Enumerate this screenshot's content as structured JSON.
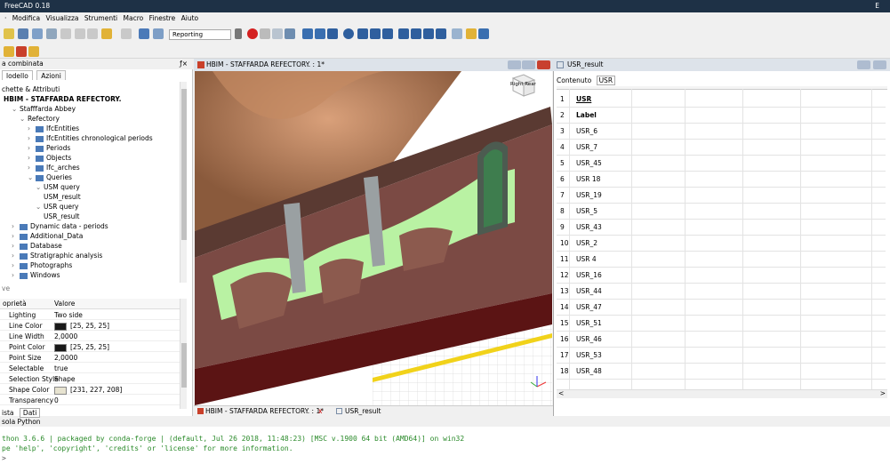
{
  "window": {
    "title": "FreeCAD 0.18",
    "control": "E"
  },
  "menu": [
    "Modifica",
    "Visualizza",
    "Strumenti",
    "Macro",
    "Finestre",
    "Aiuto"
  ],
  "toolbar": {
    "workbench": "Reporting"
  },
  "left_panel": {
    "title": "a combinata",
    "tabs": [
      "lodello",
      "Azioni"
    ],
    "section": "chette & Attributi",
    "tree": [
      {
        "indent": 0,
        "label": "HBIM - STAFFARDA REFECTORY.",
        "bold": true,
        "icon": "document-icon"
      },
      {
        "indent": 1,
        "label": "Stafffarda Abbey",
        "caret": "v"
      },
      {
        "indent": 2,
        "label": "Refectory",
        "caret": "v"
      },
      {
        "indent": 3,
        "label": "IfcEntities",
        "caret": ">",
        "icon": "folder"
      },
      {
        "indent": 3,
        "label": "IfcEntities chronological periods",
        "caret": ">",
        "icon": "folder"
      },
      {
        "indent": 3,
        "label": "Periods",
        "caret": ">",
        "icon": "folder"
      },
      {
        "indent": 3,
        "label": "Objects",
        "caret": ">",
        "icon": "folder"
      },
      {
        "indent": 3,
        "label": "Ifc_arches",
        "caret": ">",
        "icon": "folder"
      },
      {
        "indent": 3,
        "label": "Queries",
        "caret": "v",
        "icon": "folder"
      },
      {
        "indent": 4,
        "label": "USM query",
        "caret": "v"
      },
      {
        "indent": 5,
        "label": "USM_result"
      },
      {
        "indent": 4,
        "label": "USR query",
        "caret": "v"
      },
      {
        "indent": 5,
        "label": "USR_result"
      },
      {
        "indent": 1,
        "label": "Dynamic data - periods",
        "caret": ">",
        "icon": "folder"
      },
      {
        "indent": 1,
        "label": "Additional_Data",
        "caret": ">",
        "icon": "folder"
      },
      {
        "indent": 1,
        "label": "Database",
        "caret": ">",
        "icon": "folder"
      },
      {
        "indent": 1,
        "label": "Stratigraphic analysis",
        "caret": ">",
        "icon": "folder"
      },
      {
        "indent": 1,
        "label": "Photographs",
        "caret": ">",
        "icon": "folder"
      },
      {
        "indent": 1,
        "label": "Windows",
        "caret": ">",
        "icon": "folder"
      }
    ],
    "sub_label": "ve",
    "props_header": {
      "prop": "oprietà",
      "value": "Valore"
    },
    "props": [
      {
        "k": "Lighting",
        "v": "Two side"
      },
      {
        "k": "Line Color",
        "v": "[25, 25, 25]",
        "swatch": "#191919"
      },
      {
        "k": "Line Width",
        "v": "2,0000"
      },
      {
        "k": "Point Color",
        "v": "[25, 25, 25]",
        "swatch": "#191919"
      },
      {
        "k": "Point Size",
        "v": "2,0000"
      },
      {
        "k": "Selectable",
        "v": "true"
      },
      {
        "k": "Selection Style",
        "v": "Shape"
      },
      {
        "k": "Shape Color",
        "v": "[231, 227, 208]",
        "swatch": "#e7e3d0"
      },
      {
        "k": "Transparency",
        "v": "0"
      }
    ],
    "bottom_tabs": [
      "ista",
      "Dati"
    ]
  },
  "view3d": {
    "title": "HBIM - STAFFARDA REFECTORY. : 1*",
    "cube_label": "Right Rear"
  },
  "doc_tabs": [
    "HBIM - STAFFARDA REFECTORY. : 1*",
    "USR_result"
  ],
  "sheet": {
    "title": "USR_result",
    "content_label": "Contenuto",
    "content_value": "USR",
    "rows": [
      {
        "n": "1",
        "v": "USR",
        "bold": true
      },
      {
        "n": "2",
        "v": "Label",
        "bold": true
      },
      {
        "n": "3",
        "v": "USR_6"
      },
      {
        "n": "4",
        "v": "USR_7"
      },
      {
        "n": "5",
        "v": "USR_45"
      },
      {
        "n": "6",
        "v": "USR 18"
      },
      {
        "n": "7",
        "v": "USR_19"
      },
      {
        "n": "8",
        "v": "USR_5"
      },
      {
        "n": "9",
        "v": "USR_43"
      },
      {
        "n": "10",
        "v": "USR_2"
      },
      {
        "n": "11",
        "v": "USR 4"
      },
      {
        "n": "12",
        "v": "USR_16"
      },
      {
        "n": "13",
        "v": "USR_44"
      },
      {
        "n": "14",
        "v": "USR_47"
      },
      {
        "n": "15",
        "v": "USR_51"
      },
      {
        "n": "16",
        "v": "USR_46"
      },
      {
        "n": "17",
        "v": "USR_53"
      },
      {
        "n": "18",
        "v": "USR_48"
      }
    ]
  },
  "console": {
    "title": "sola Python",
    "lines": [
      "thon 3.6.6 | packaged by conda-forge | (default, Jul 26 2018, 11:48:23) [MSC v.1900 64 bit (AMD64)] on win32",
      "pe 'help', 'copyright', 'credits' or 'license' for more information.",
      ">"
    ]
  }
}
